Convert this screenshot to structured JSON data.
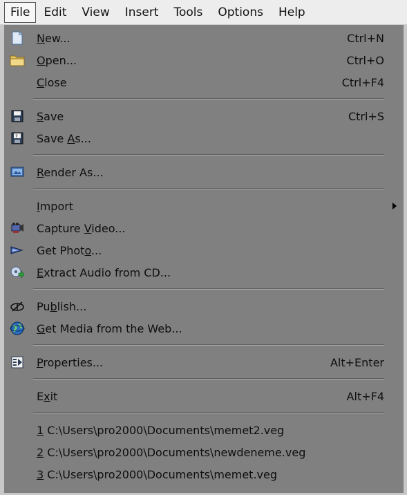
{
  "menubar": {
    "items": [
      "File",
      "Edit",
      "View",
      "Insert",
      "Tools",
      "Options",
      "Help"
    ]
  },
  "file_menu": {
    "new": {
      "pre": "",
      "key": "N",
      "post": "ew...",
      "shortcut": "Ctrl+N",
      "icon": "new-document-icon"
    },
    "open": {
      "pre": "",
      "key": "O",
      "post": "pen...",
      "shortcut": "Ctrl+O",
      "icon": "folder-icon"
    },
    "close": {
      "pre": "",
      "key": "C",
      "post": "lose",
      "shortcut": "Ctrl+F4"
    },
    "save": {
      "pre": "",
      "key": "S",
      "post": "ave",
      "shortcut": "Ctrl+S",
      "icon": "floppy-disk-icon"
    },
    "save_as": {
      "pre": "Save ",
      "key": "A",
      "post": "s...",
      "icon": "save-as-icon"
    },
    "render_as": {
      "pre": "",
      "key": "R",
      "post": "ender As...",
      "icon": "render-icon"
    },
    "import": {
      "pre": "",
      "key": "I",
      "post": "mport"
    },
    "capture_video": {
      "pre": "Capture ",
      "key": "V",
      "post": "ideo...",
      "icon": "capture-video-icon"
    },
    "get_photo": {
      "pre": "Get Phot",
      "key": "o",
      "post": "...",
      "icon": "get-photo-icon"
    },
    "extract_audio": {
      "pre": "",
      "key": "E",
      "post": "xtract Audio from CD...",
      "icon": "extract-audio-icon"
    },
    "publish": {
      "pre": "Pu",
      "key": "b",
      "post": "lish...",
      "icon": "publish-icon"
    },
    "get_media": {
      "pre": "",
      "key": "G",
      "post": "et Media from the Web...",
      "icon": "globe-icon"
    },
    "properties": {
      "pre": "",
      "key": "P",
      "post": "roperties...",
      "shortcut": "Alt+Enter",
      "icon": "properties-icon"
    },
    "exit": {
      "pre": "E",
      "key": "x",
      "post": "it",
      "shortcut": "Alt+F4"
    },
    "recent": [
      {
        "key": "1",
        "path": " C:\\Users\\pro2000\\Documents\\memet2.veg"
      },
      {
        "key": "2",
        "path": " C:\\Users\\pro2000\\Documents\\newdeneme.veg"
      },
      {
        "key": "3",
        "path": " C:\\Users\\pro2000\\Documents\\memet.veg"
      }
    ]
  }
}
